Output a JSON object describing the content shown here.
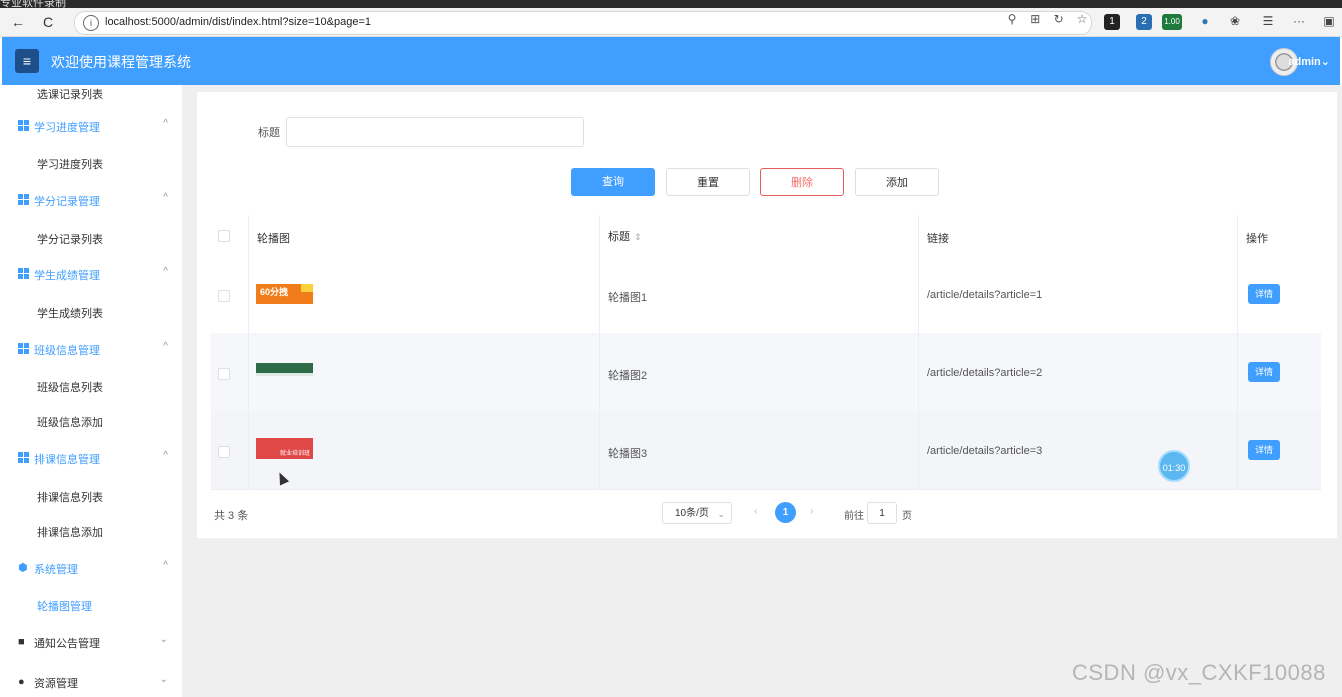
{
  "recorder": {
    "label": "专业软件录制"
  },
  "browser": {
    "url": "localhost:5000/admin/dist/index.html?size=10&page=1",
    "back_icon": "←",
    "reload_icon": "C",
    "info_icon": "i",
    "ext_badges": [
      "1",
      "2",
      "1.00"
    ],
    "menu_icon": "···"
  },
  "header": {
    "title": "欢迎使用课程管理系统",
    "user": "admin",
    "menu_icon": "≡"
  },
  "sidebar": {
    "top_item": "选课记录列表",
    "groups": [
      {
        "label": "学习进度管理",
        "items": [
          "学习进度列表"
        ]
      },
      {
        "label": "学分记录管理",
        "items": [
          "学分记录列表"
        ]
      },
      {
        "label": "学生成绩管理",
        "items": [
          "学生成绩列表"
        ]
      },
      {
        "label": "班级信息管理",
        "items": [
          "班级信息列表",
          "班级信息添加"
        ]
      },
      {
        "label": "排课信息管理",
        "items": [
          "排课信息列表",
          "排课信息添加"
        ]
      },
      {
        "label": "系统管理",
        "items": [
          "轮播图管理"
        ]
      },
      {
        "label": "通知公告管理",
        "items": []
      },
      {
        "label": "资源管理",
        "items": []
      }
    ],
    "chevron_up": "^",
    "chevron_down": "⌄"
  },
  "search": {
    "label": "标题",
    "value": "",
    "placeholder": ""
  },
  "buttons": {
    "query": "查询",
    "reset": "重置",
    "delete": "删除",
    "add": "添加"
  },
  "table": {
    "columns": [
      "轮播图",
      "标题",
      "链接",
      "操作"
    ],
    "sort_icon": "⇕",
    "rows": [
      {
        "title": "轮播图1",
        "link": "/article/details?article=1",
        "action": "详情",
        "thumb_text": "60分拽"
      },
      {
        "title": "轮播图2",
        "link": "/article/details?article=2",
        "action": "详情",
        "thumb_text": ""
      },
      {
        "title": "轮播图3",
        "link": "/article/details?article=3",
        "action": "详情",
        "thumb_text": "就业培训班"
      }
    ]
  },
  "pagination": {
    "total": "共 3 条",
    "page_size": "10条/页",
    "current_page": "1",
    "goto_prefix": "前往",
    "goto_value": "1",
    "goto_suffix": "页",
    "prev": "‹",
    "next": "›"
  },
  "overlay": {
    "timer": "01:30",
    "watermark": "CSDN @vx_CXKF10088"
  },
  "colors": {
    "primary": "#409eff",
    "danger": "#f56c6c",
    "content_bg": "#efefef"
  }
}
